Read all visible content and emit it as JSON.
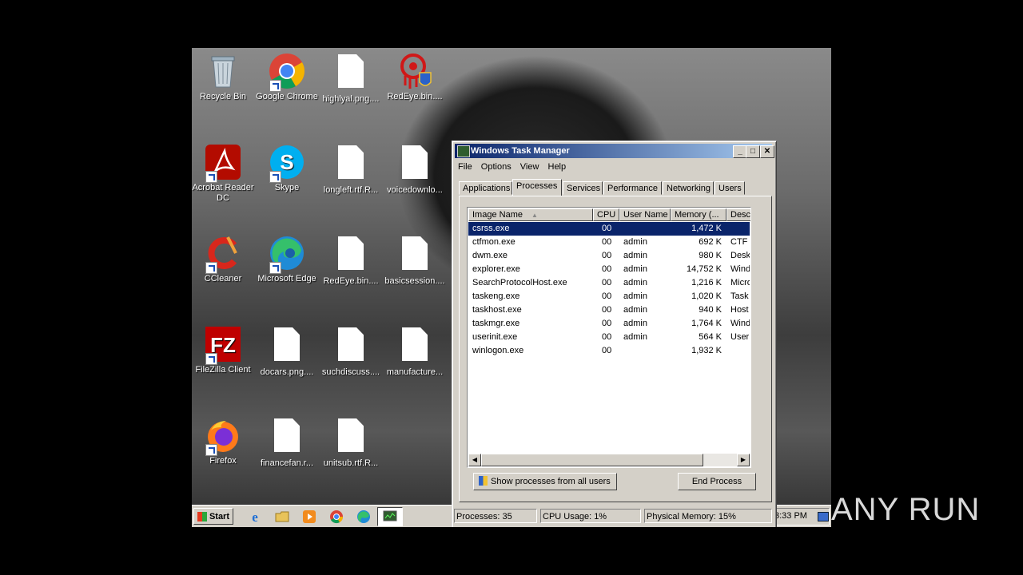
{
  "desktop": {
    "icons": [
      {
        "label": "Recycle Bin",
        "icon": "recycle-bin-icon"
      },
      {
        "label": "Google Chrome",
        "icon": "chrome-icon"
      },
      {
        "label": "highlyal.png....",
        "icon": "file-icon"
      },
      {
        "label": "RedEye.bin....",
        "icon": "redeye-icon"
      },
      {
        "label": "Acrobat Reader DC",
        "icon": "acrobat-icon"
      },
      {
        "label": "Skype",
        "icon": "skype-icon"
      },
      {
        "label": "longleft.rtf.R...",
        "icon": "file-icon"
      },
      {
        "label": "voicedownlo...",
        "icon": "file-icon"
      },
      {
        "label": "CCleaner",
        "icon": "ccleaner-icon"
      },
      {
        "label": "Microsoft Edge",
        "icon": "edge-icon"
      },
      {
        "label": "RedEye.bin....",
        "icon": "file-icon"
      },
      {
        "label": "basicsession....",
        "icon": "file-icon"
      },
      {
        "label": "FileZilla Client",
        "icon": "filezilla-icon"
      },
      {
        "label": "docars.png....",
        "icon": "file-icon"
      },
      {
        "label": "suchdiscuss....",
        "icon": "file-icon"
      },
      {
        "label": "manufacture...",
        "icon": "file-icon"
      },
      {
        "label": "Firefox",
        "icon": "firefox-icon"
      },
      {
        "label": "financefan.r...",
        "icon": "file-icon"
      },
      {
        "label": "unitsub.rtf.R...",
        "icon": "file-icon"
      }
    ]
  },
  "taskbar": {
    "start_label": "Start",
    "clock": "3:33 PM"
  },
  "task_manager": {
    "title": "Windows Task Manager",
    "menu": [
      "File",
      "Options",
      "View",
      "Help"
    ],
    "tabs": [
      "Applications",
      "Processes",
      "Services",
      "Performance",
      "Networking",
      "Users"
    ],
    "active_tab": "Processes",
    "columns": [
      "Image Name",
      "CPU",
      "User Name",
      "Memory (...",
      "Desc"
    ],
    "rows": [
      {
        "name": "csrss.exe",
        "cpu": "00",
        "user": "",
        "mem": "1,472 K",
        "desc": ""
      },
      {
        "name": "ctfmon.exe",
        "cpu": "00",
        "user": "admin",
        "mem": "692 K",
        "desc": "CTF I"
      },
      {
        "name": "dwm.exe",
        "cpu": "00",
        "user": "admin",
        "mem": "980 K",
        "desc": "Desk"
      },
      {
        "name": "explorer.exe",
        "cpu": "00",
        "user": "admin",
        "mem": "14,752 K",
        "desc": "Wind"
      },
      {
        "name": "SearchProtocolHost.exe",
        "cpu": "00",
        "user": "admin",
        "mem": "1,216 K",
        "desc": "Micro"
      },
      {
        "name": "taskeng.exe",
        "cpu": "00",
        "user": "admin",
        "mem": "1,020 K",
        "desc": "Task"
      },
      {
        "name": "taskhost.exe",
        "cpu": "00",
        "user": "admin",
        "mem": "940 K",
        "desc": "Host"
      },
      {
        "name": "taskmgr.exe",
        "cpu": "00",
        "user": "admin",
        "mem": "1,764 K",
        "desc": "Wind"
      },
      {
        "name": "userinit.exe",
        "cpu": "00",
        "user": "admin",
        "mem": "564 K",
        "desc": "Useri"
      },
      {
        "name": "winlogon.exe",
        "cpu": "00",
        "user": "",
        "mem": "1,932 K",
        "desc": ""
      }
    ],
    "show_all_label": "Show processes from all users",
    "end_process_label": "End Process",
    "status": {
      "processes": "Processes: 35",
      "cpu": "CPU Usage: 1%",
      "memory": "Physical Memory: 15%"
    }
  },
  "watermark": "ANY RUN",
  "colors": {
    "selection": "#0a246a",
    "titlebar_start": "#0a246a",
    "titlebar_end": "#a6caf0",
    "window_face": "#d4d0c8"
  }
}
